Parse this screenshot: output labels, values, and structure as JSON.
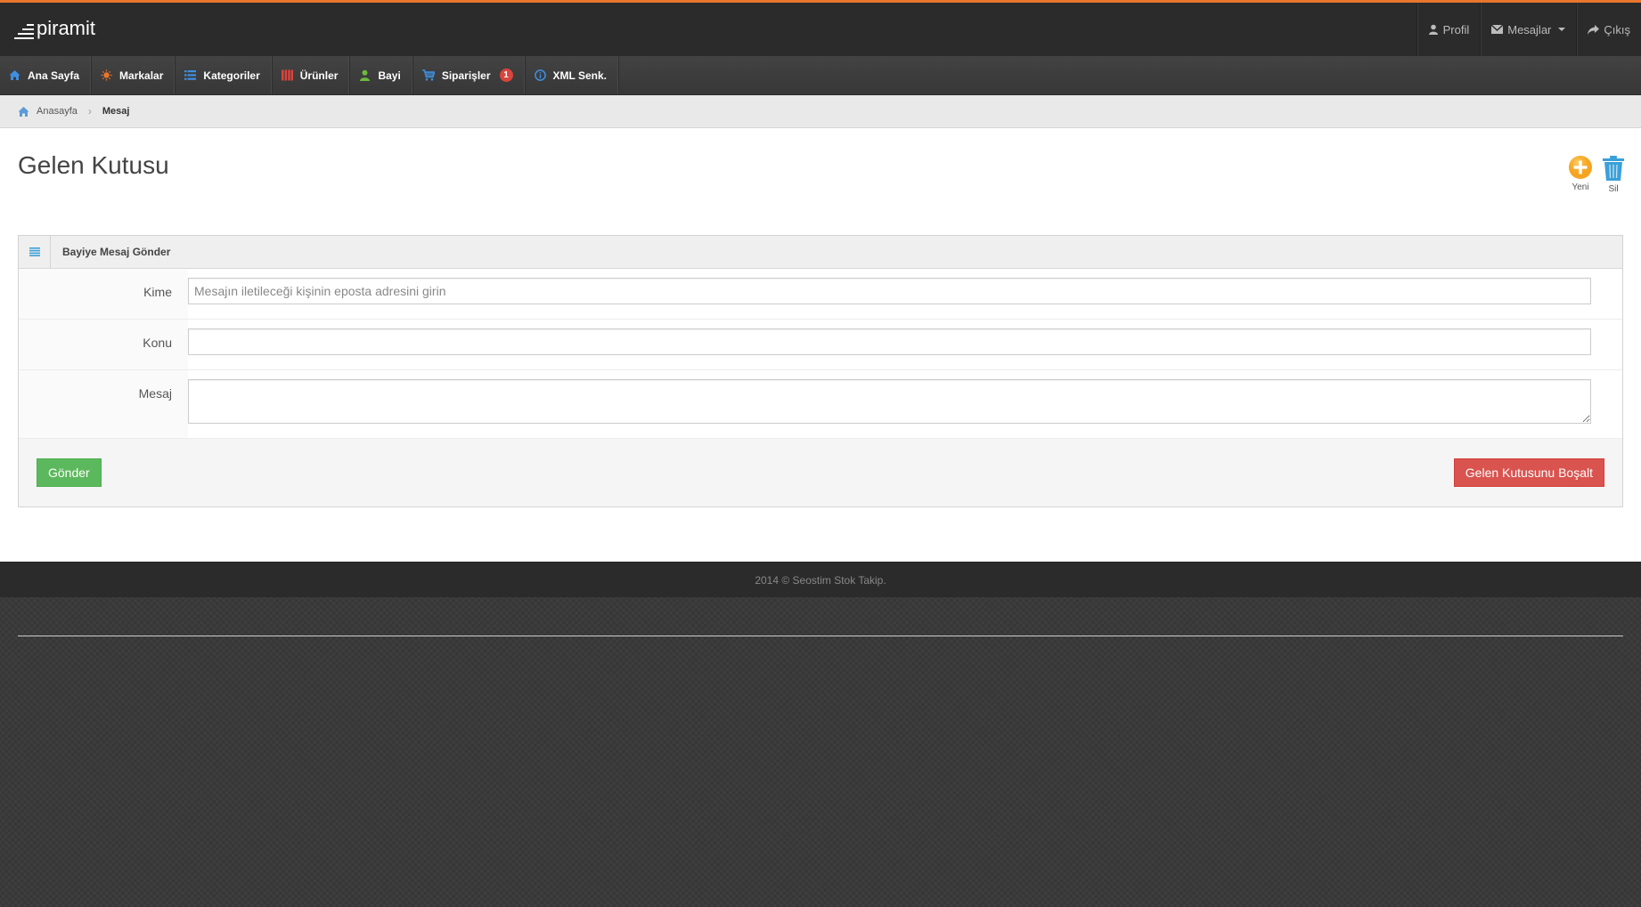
{
  "brand": {
    "name": "piramit"
  },
  "topnav": {
    "profile": "Profil",
    "messages": "Mesajlar",
    "logout": "Çıkış"
  },
  "menu": {
    "items": [
      {
        "label": "Ana Sayfa",
        "icon": "home-icon",
        "color": "#3f8fe0"
      },
      {
        "label": "Markalar",
        "icon": "sun-icon",
        "color": "#e8762d"
      },
      {
        "label": "Kategoriler",
        "icon": "list-icon",
        "color": "#3f8fe0"
      },
      {
        "label": "Ürünler",
        "icon": "columns-icon",
        "color": "#d9443d"
      },
      {
        "label": "Bayi",
        "icon": "user-icon",
        "color": "#6cba3a"
      },
      {
        "label": "Siparişler",
        "icon": "cart-icon",
        "color": "#3f8fe0",
        "badge": "1"
      },
      {
        "label": "XML Senk.",
        "icon": "info-icon",
        "color": "#3f8fe0"
      }
    ]
  },
  "breadcrumb": {
    "home": "Anasayfa",
    "current": "Mesaj"
  },
  "page": {
    "title": "Gelen Kutusu"
  },
  "actions": {
    "new_label": "Yeni",
    "delete_label": "Sil"
  },
  "panel": {
    "title": "Bayiye Mesaj Gönder"
  },
  "form": {
    "to_label": "Kime",
    "to_placeholder": "Mesajın iletileceği kişinin eposta adresini girin",
    "to_value": "",
    "subject_label": "Konu",
    "subject_value": "",
    "message_label": "Mesaj",
    "message_value": "",
    "send_label": "Gönder",
    "empty_label": "Gelen Kutusunu Boşalt"
  },
  "footer": {
    "text": "2014 © Seostim Stok Takip."
  }
}
